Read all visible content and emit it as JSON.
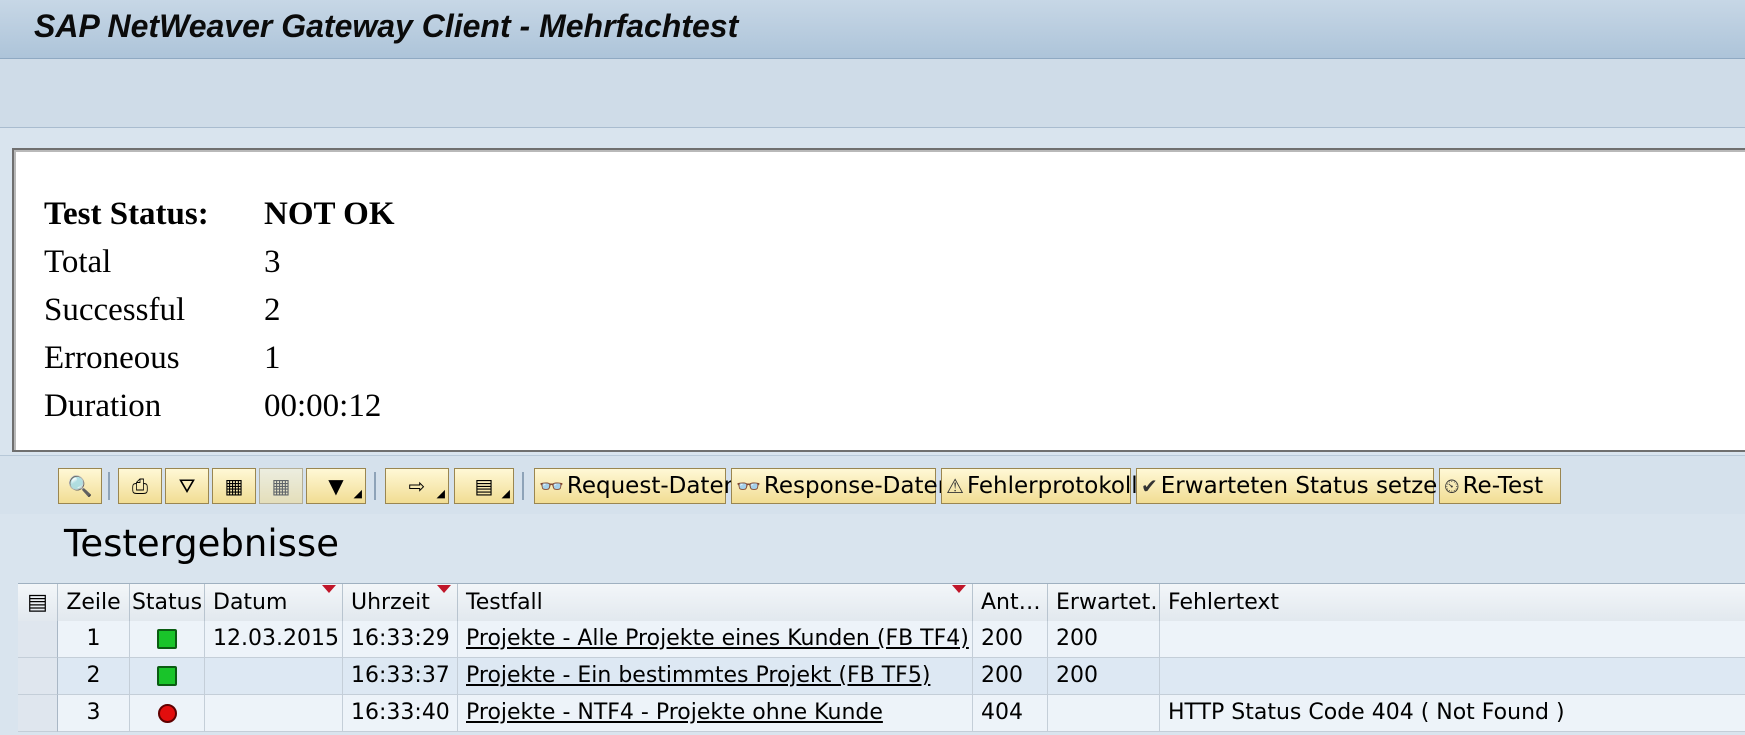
{
  "window": {
    "title": "SAP NetWeaver Gateway Client - Mehrfachtest"
  },
  "summary": {
    "rows": [
      {
        "label": "Test Status:",
        "value": "NOT OK"
      },
      {
        "label": "Total",
        "value": "3"
      },
      {
        "label": "Successful",
        "value": "2"
      },
      {
        "label": "Erroneous",
        "value": "1"
      },
      {
        "label": "Duration",
        "value": "00:00:12"
      }
    ]
  },
  "toolbar": {
    "request_label": "Request-Daten",
    "response_label": "Response-Daten",
    "errorlog_label": "Fehlerprotokoll",
    "setstatus_label": "Erwarteten Status setzen",
    "retest_label": "Re-Test"
  },
  "results": {
    "title": "Testergebnisse",
    "columns": [
      "Zeile",
      "Status",
      "Datum",
      "Uhrzeit",
      "Testfall",
      "Ant…",
      "Erwartet…",
      "Fehlertext"
    ],
    "rows": [
      {
        "zeile": "1",
        "status": "green",
        "datum": "12.03.2015",
        "uhrzeit": "16:33:29",
        "testfall": "Projekte - Alle Projekte eines Kunden (FB TF4)",
        "ant": "200",
        "erwartet": "200",
        "fehlertext": ""
      },
      {
        "zeile": "2",
        "status": "green",
        "datum": "",
        "uhrzeit": "16:33:37",
        "testfall": "Projekte - Ein bestimmtes Projekt (FB TF5)",
        "ant": "200",
        "erwartet": "200",
        "fehlertext": ""
      },
      {
        "zeile": "3",
        "status": "red",
        "datum": "",
        "uhrzeit": "16:33:40",
        "testfall": "Projekte - NTF4 - Projekte ohne Kunde",
        "ant": "404",
        "erwartet": "",
        "fehlertext": "HTTP Status Code 404 ( Not Found )"
      }
    ]
  },
  "colors": {
    "status_ok": "#19c42a",
    "status_error": "#e20d0d",
    "button_bg": "#f1dd93"
  }
}
